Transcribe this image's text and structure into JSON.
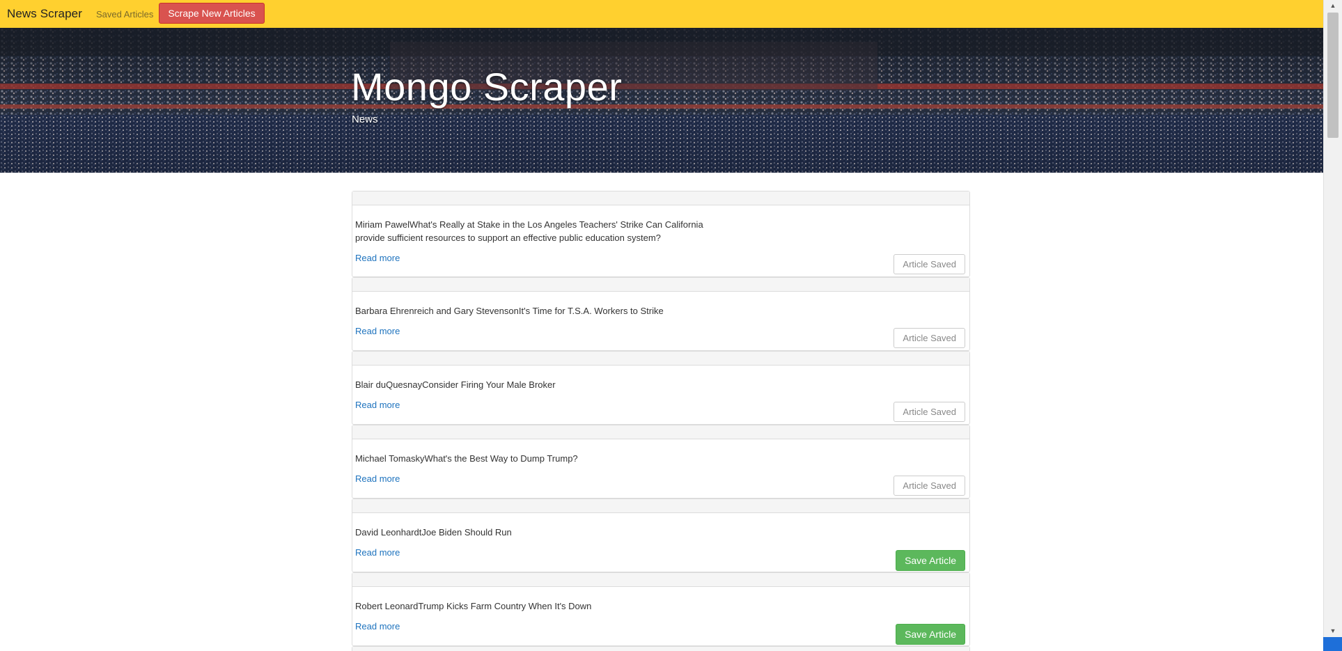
{
  "navbar": {
    "brand": "News Scraper",
    "saved_link": "Saved Articles",
    "scrape_button": "Scrape New Articles",
    "bg_color": "#ffd02f"
  },
  "hero": {
    "title": "Mongo Scraper",
    "subtitle": "News"
  },
  "articles": [
    {
      "text": "Miriam PawelWhat's Really at Stake in the Los Angeles Teachers' Strike Can California provide sufficient resources to support an effective public education system?",
      "read_more": "Read more",
      "button": "Article Saved",
      "saved": true
    },
    {
      "text": "Barbara Ehrenreich and Gary StevensonIt's Time for T.S.A. Workers to Strike",
      "read_more": "Read more",
      "button": "Article Saved",
      "saved": true
    },
    {
      "text": "Blair duQuesnayConsider Firing Your Male Broker",
      "read_more": "Read more",
      "button": "Article Saved",
      "saved": true
    },
    {
      "text": "Michael TomaskyWhat's the Best Way to Dump Trump?",
      "read_more": "Read more",
      "button": "Article Saved",
      "saved": true
    },
    {
      "text": "David LeonhardtJoe Biden Should Run",
      "read_more": "Read more",
      "button": "Save Article",
      "saved": false
    },
    {
      "text": "Robert LeonardTrump Kicks Farm Country When It's Down",
      "read_more": "Read more",
      "button": "Save Article",
      "saved": false
    }
  ]
}
